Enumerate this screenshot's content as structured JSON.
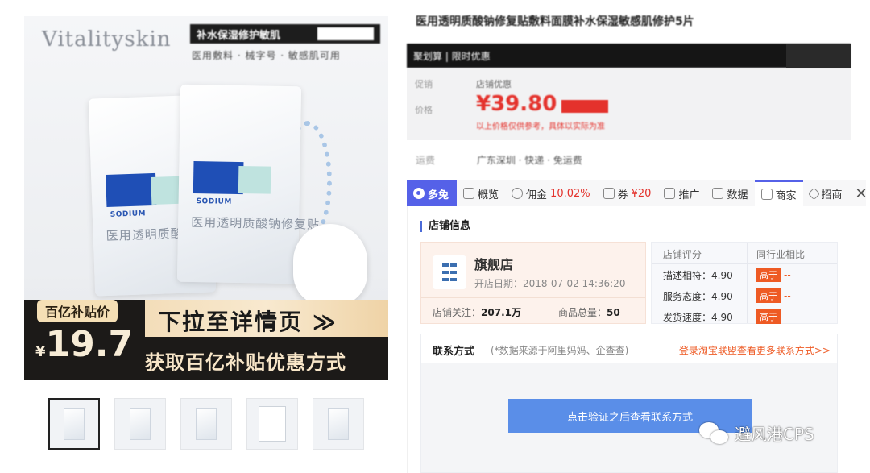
{
  "colors": {
    "accent": "#5561e8",
    "price_red": "#e4322c",
    "orange": "#ee5a24",
    "button_blue": "#5a8ee8",
    "gold": "#f5dfb5"
  },
  "gallery": {
    "brand": "Vitalityskin",
    "promo_tag": "补水保湿修护敏肌",
    "promo_sub": "医用敷料 · 械字号 · 敏感肌可用",
    "product_en": "SODIUM",
    "product_cn": "医用透明质酸钠修复贴",
    "subsidy_badge": "百亿补贴价",
    "price_currency": "¥",
    "price_value": "19.7",
    "cta_line1": "下拉至详情页 ≫",
    "cta_line2": "获取百亿补贴优惠方式",
    "zoom_icon": "search-icon",
    "thumbnails": [
      "thumb-1",
      "thumb-2",
      "thumb-3",
      "thumb-4",
      "thumb-5"
    ]
  },
  "product": {
    "title": "医用透明质酸钠修复贴敷料面膜补水保湿敏感肌修护5片",
    "promo_bar": "聚划算 | 限时优惠",
    "label_sale": "促销",
    "value_sale": "店铺优惠",
    "label_price": "价格",
    "price": "¥39.80",
    "price_note": "以上价格仅供参考，具体以实际为准",
    "misc_label": "运费",
    "misc_value": "广东深圳 · 快递 · 免运费"
  },
  "tabs": [
    {
      "id": "duotu",
      "label": "多兔",
      "icon": "rabbit-icon"
    },
    {
      "id": "overview",
      "label": "概览",
      "icon": "chart-icon"
    },
    {
      "id": "commission",
      "label": "佣金",
      "value": "10.02%",
      "icon": "yen-icon"
    },
    {
      "id": "coupon",
      "label": "券",
      "value": "¥20",
      "icon": "ticket-icon"
    },
    {
      "id": "promote",
      "label": "推广",
      "icon": "megaphone-icon"
    },
    {
      "id": "data",
      "label": "数据",
      "icon": "bar-chart-icon"
    },
    {
      "id": "merchant",
      "label": "商家",
      "icon": "shop-icon"
    },
    {
      "id": "recruit",
      "label": "招商",
      "icon": "diamond-icon"
    }
  ],
  "shop": {
    "section_title": "店铺信息",
    "name": "旗舰店",
    "open_date": "开店日期：2018-07-02 14:36:20",
    "follow_label": "店铺关注：",
    "follow_value": "207.1万",
    "total_label": "商品总量：",
    "total_value": "50",
    "rating_header": "店铺评分",
    "compare_header": "同行业相比",
    "ratings": [
      {
        "label": "描述相符：",
        "value": "4.90",
        "level": "高于",
        "dash": "--"
      },
      {
        "label": "服务态度：",
        "value": "4.90",
        "level": "高于",
        "dash": "--"
      },
      {
        "label": "发货速度：",
        "value": "4.90",
        "level": "高于",
        "dash": "--"
      }
    ]
  },
  "contact": {
    "title": "联系方式",
    "note": "(*数据来源于阿里妈妈、企查查)",
    "link": "登录淘宝联盟查看更多联系方式>>",
    "button": "点击验证之后查看联系方式"
  },
  "watermark": {
    "text": "避风港CPS",
    "icon": "wechat-icon"
  }
}
